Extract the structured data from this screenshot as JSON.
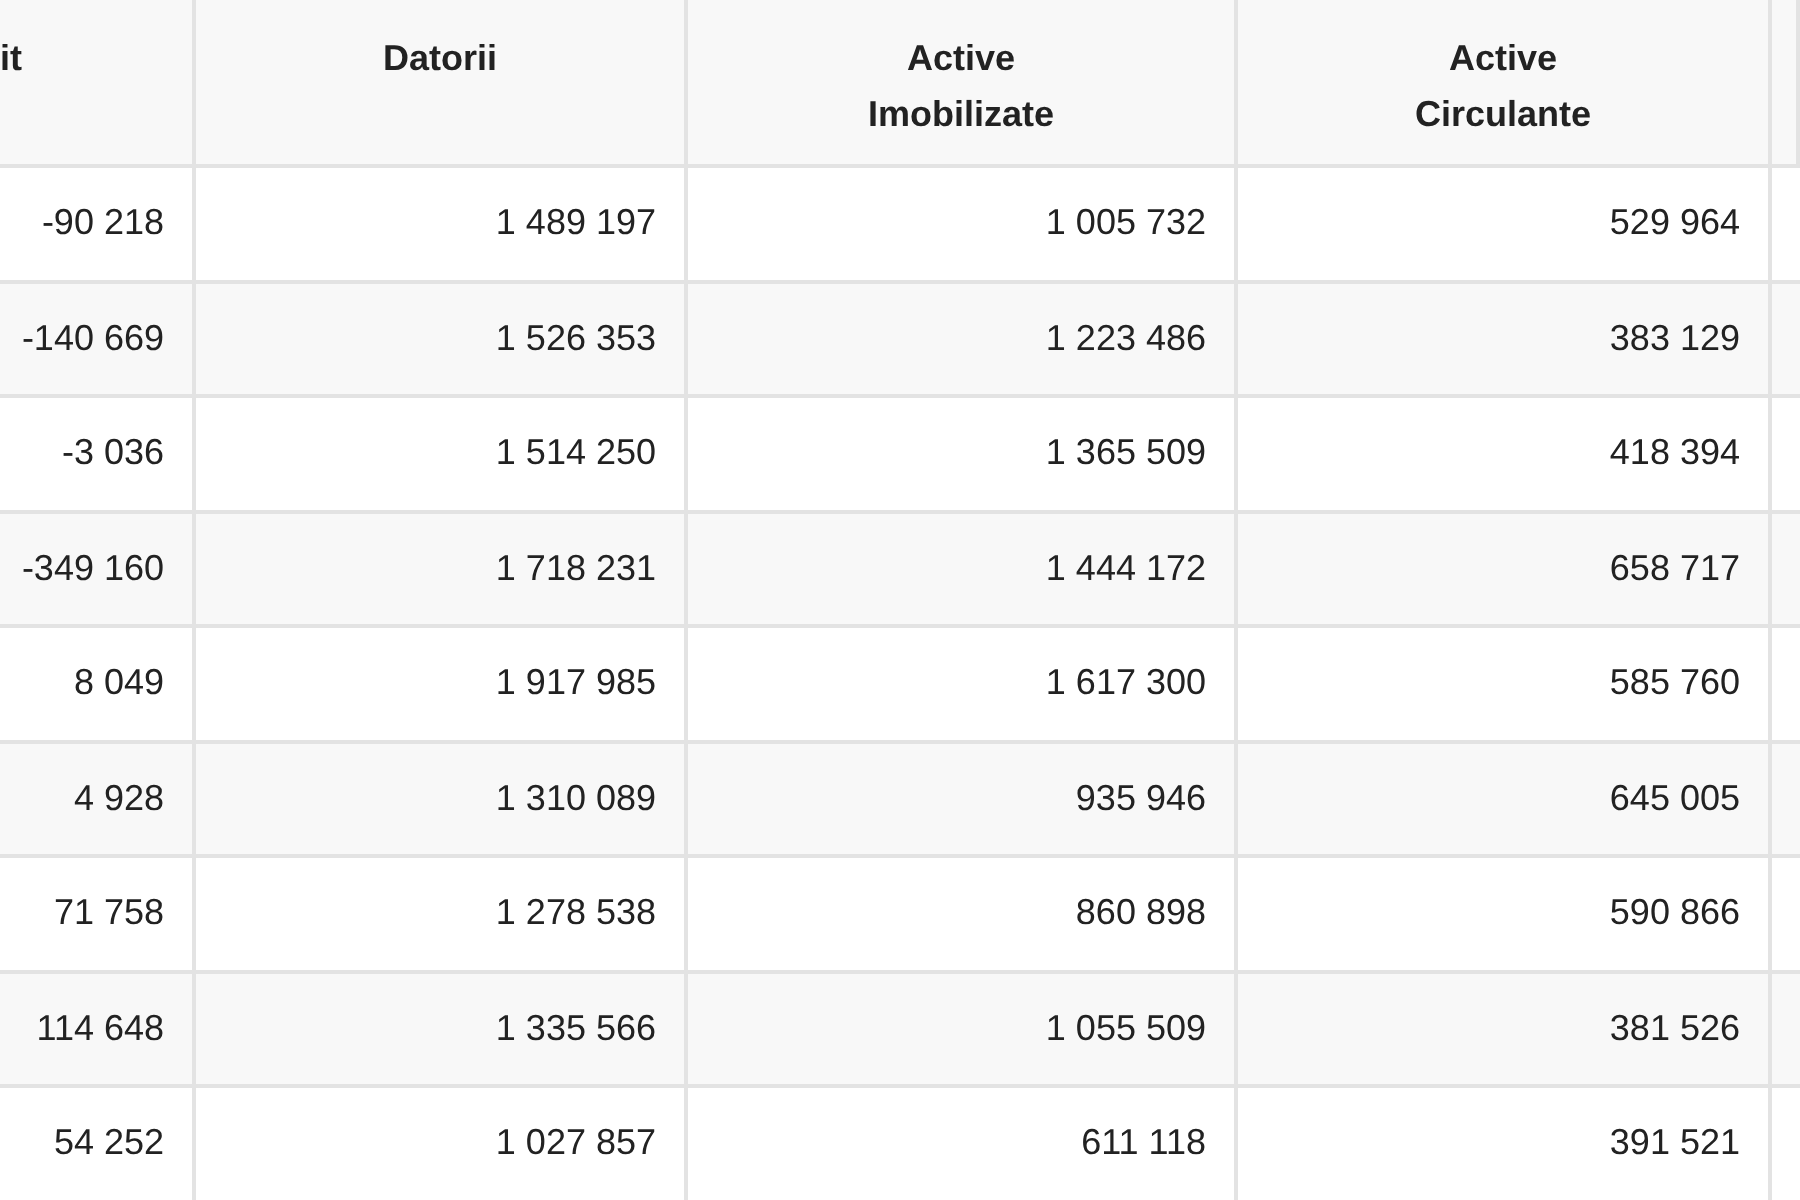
{
  "table": {
    "columns": [
      "it",
      "Datorii",
      "Active\nImobilizate",
      "Active\nCirculante"
    ],
    "rows": [
      [
        "-90 218",
        "1 489 197",
        "1 005 732",
        "529 964"
      ],
      [
        "-140 669",
        "1 526 353",
        "1 223 486",
        "383 129"
      ],
      [
        "-3 036",
        "1 514 250",
        "1 365 509",
        "418 394"
      ],
      [
        "-349 160",
        "1 718 231",
        "1 444 172",
        "658 717"
      ],
      [
        "8 049",
        "1 917 985",
        "1 617 300",
        "585 760"
      ],
      [
        "4 928",
        "1 310 089",
        "935 946",
        "645 005"
      ],
      [
        "71 758",
        "1 278 538",
        "860 898",
        "590 866"
      ],
      [
        "114 648",
        "1 335 566",
        "1 055 509",
        "381 526"
      ],
      [
        "54 252",
        "1 027 857",
        "611 118",
        "391 521"
      ]
    ]
  }
}
